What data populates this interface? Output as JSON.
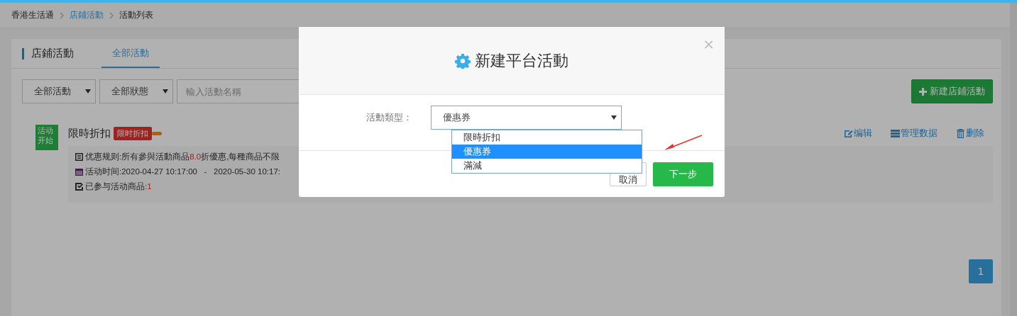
{
  "breadcrumb": [
    {
      "label": "香港生活通",
      "kind": "text"
    },
    {
      "label": "店鋪活動",
      "kind": "link"
    },
    {
      "label": "活動列表",
      "kind": "text"
    }
  ],
  "panel": {
    "title": "店鋪活動",
    "tabs": [
      {
        "label": "全部活動",
        "selected": true
      }
    ]
  },
  "filters": {
    "type_select": "全部活動",
    "status_select": "全部狀態",
    "search_placeholder": "輸入活動名稱",
    "new_button": "新建店鋪活動"
  },
  "activities": [
    {
      "status_badge": "活动开始",
      "name": "限時折扣",
      "tag": "限时折扣",
      "actions": [
        {
          "label": "编辑",
          "kind": "edit"
        },
        {
          "label": "管理数据",
          "kind": "data"
        },
        {
          "label": "删除",
          "kind": "delete"
        }
      ],
      "rule": "优惠规则:所有參與活動商品**8.0**折優惠,每種商品不限",
      "time": "活动时间:2020-04-27 10:17:00   -   2020-05-30 10:17:",
      "products_label": "已参与活动商品:",
      "products_count": "1"
    }
  ],
  "pagination": [
    {
      "label": "1",
      "selected": true
    }
  ],
  "modal": {
    "title": "新建平台活動",
    "close": "×",
    "field_label": "活動類型：",
    "value": "優惠券",
    "options": [
      {
        "label": "限時折扣",
        "selected": false
      },
      {
        "label": "優惠券",
        "selected": true
      },
      {
        "label": "滿減",
        "selected": false
      }
    ],
    "cancel": "取消",
    "next": "下一步"
  }
}
